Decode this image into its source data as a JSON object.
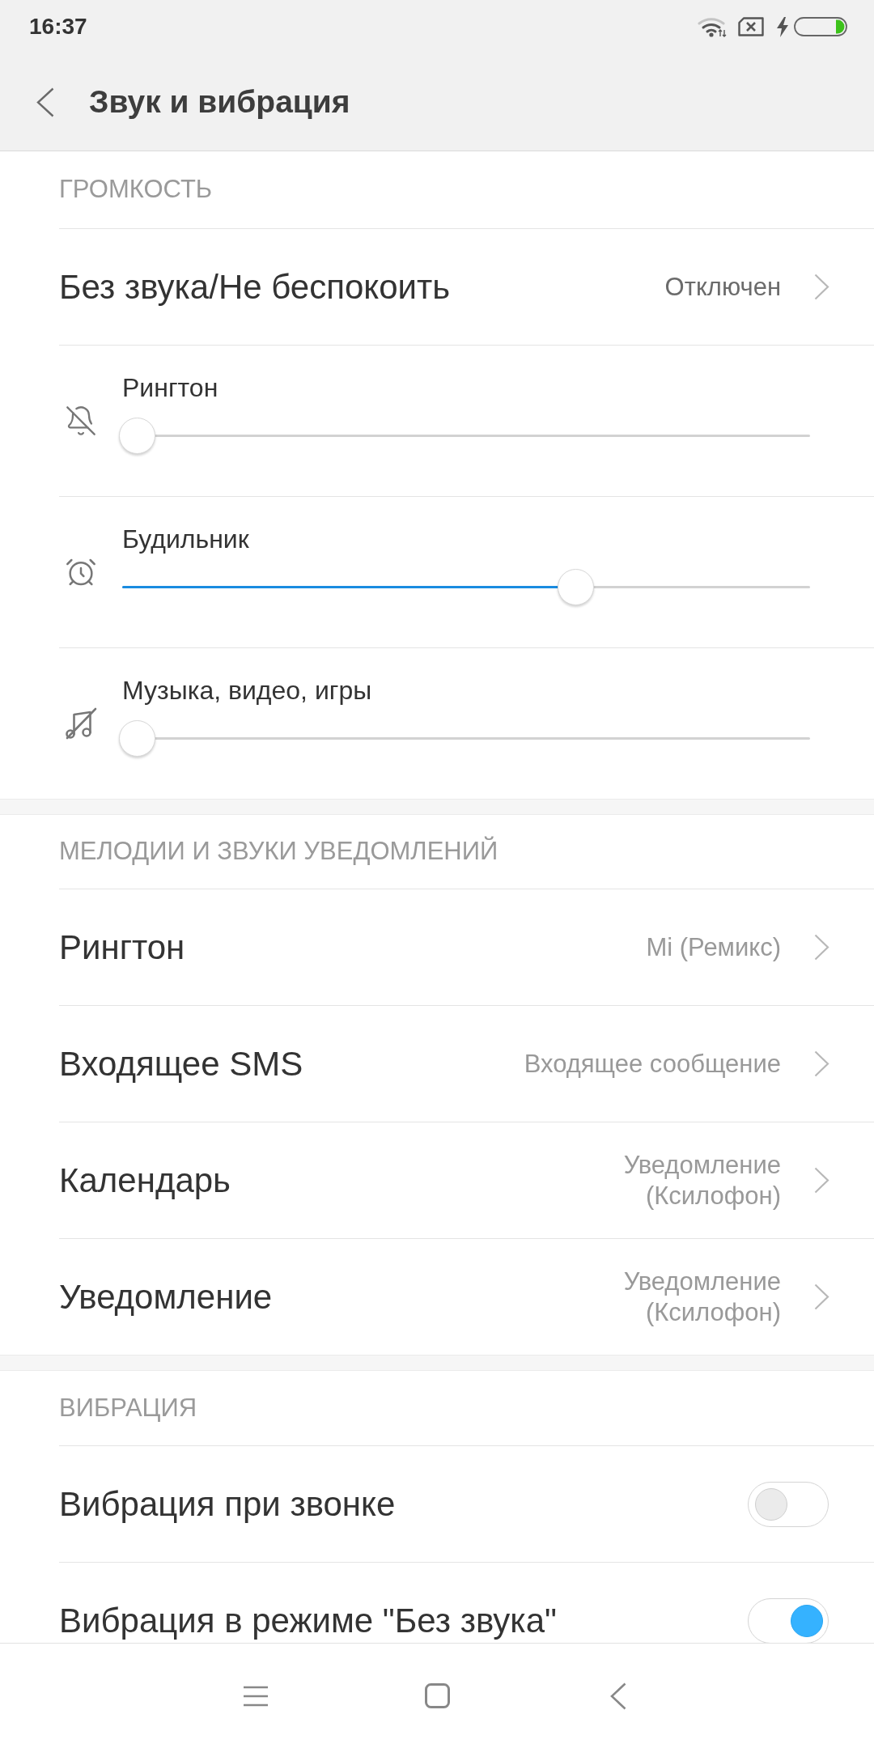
{
  "status_bar": {
    "time": "16:37"
  },
  "header": {
    "title": "Звук и вибрация"
  },
  "sections": [
    {
      "title": "ГРОМКОСТЬ",
      "items": [
        {
          "kind": "status",
          "label": "Без звука/Не беспокоить",
          "value": "Отключен"
        },
        {
          "kind": "slider",
          "label": "Рингтон",
          "level": 0
        },
        {
          "kind": "slider",
          "label": "Будильник",
          "level": 0.67
        },
        {
          "kind": "slider",
          "label": "Музыка, видео, игры",
          "level": 0
        }
      ]
    },
    {
      "title": "МЕЛОДИИ И ЗВУКИ УВЕДОМЛЕНИЙ",
      "items": [
        {
          "kind": "link",
          "label": "Рингтон",
          "value": "Mi (Ремикс)"
        },
        {
          "kind": "link",
          "label": "Входящее SMS",
          "value": "Входящее сообщение"
        },
        {
          "kind": "link",
          "label": "Календарь",
          "value": "Уведомление (Ксилофон)"
        },
        {
          "kind": "link",
          "label": "Уведомление",
          "value": "Уведомление (Ксилофон)"
        }
      ]
    },
    {
      "title": "ВИБРАЦИЯ",
      "items": [
        {
          "kind": "toggle",
          "label": "Вибрация при звонке",
          "on": false
        },
        {
          "kind": "toggle",
          "label": "Вибрация в режиме \"Без звука\"",
          "on": true
        }
      ]
    }
  ]
}
